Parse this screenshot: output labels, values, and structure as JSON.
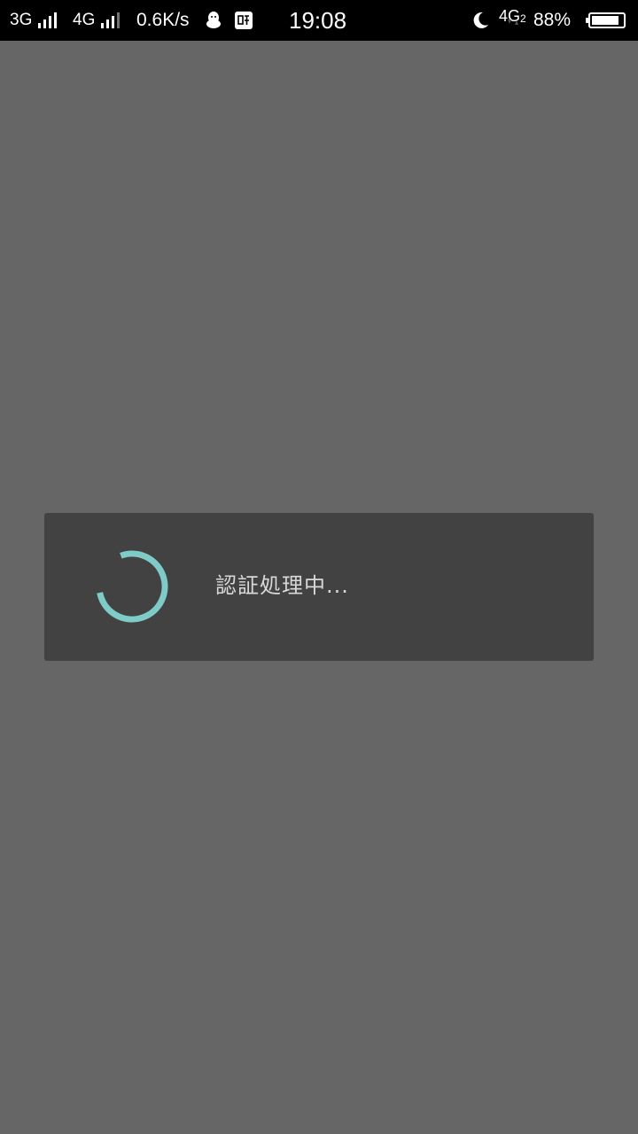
{
  "status_bar": {
    "sim1_network": "3G",
    "sim2_network": "4G",
    "net_speed": "0.6K/s",
    "clock": "19:08",
    "data_network": "4G",
    "data_sim_index": "2",
    "battery_percent": "88%",
    "battery_level": 0.88,
    "left_icons": [
      "qq-penguin-icon",
      "sticker-app-icon"
    ],
    "right_icons": [
      "moon-do-not-disturb-icon",
      "data-transfer-arrows-icon"
    ]
  },
  "loading_dialog": {
    "message": "認証処理中...",
    "spinner_color": "#7ECBC7",
    "background": "#424242"
  },
  "colors": {
    "scrim": "#666666",
    "status_bar_bg": "#000000",
    "message_text": "#D8D8D8"
  }
}
